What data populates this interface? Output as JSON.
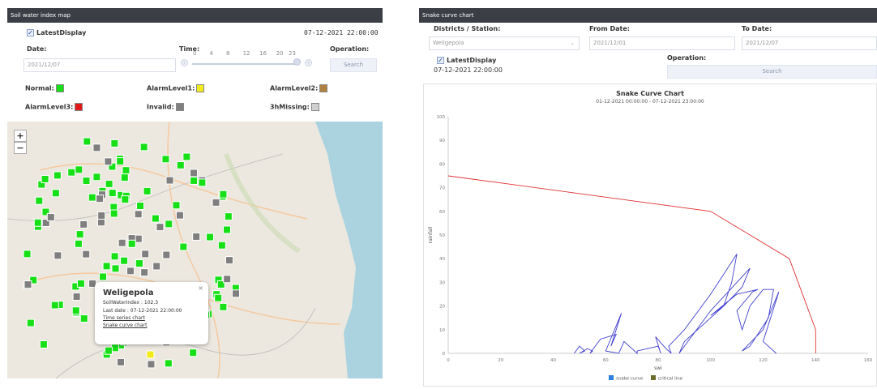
{
  "left": {
    "title": "Soil water index map",
    "latest_display_label": "LatestDisplay",
    "latest_display_checked": true,
    "timestamp": "07-12-2021 22:00:00",
    "date_label": "Date:",
    "date_value": "2021/12/07",
    "time_label": "Time:",
    "time_ticks": [
      "0",
      "4",
      "8",
      "12",
      "16",
      "20",
      "23"
    ],
    "time_slider_value": 23,
    "operation_label": "Operation:",
    "search_label": "Search",
    "legend": [
      {
        "label": "Normal:",
        "color": "#17e017"
      },
      {
        "label": "AlarmLevel1:",
        "color": "#f2ea1a"
      },
      {
        "label": "AlarmLevel2:",
        "color": "#b08040"
      },
      {
        "label": "AlarmLevel3:",
        "color": "#e01a1a"
      },
      {
        "label": "Invalid:",
        "color": "#808080"
      },
      {
        "label": "3hMissing:",
        "color": "#d0d0d0"
      }
    ],
    "zoom_in": "+",
    "zoom_out": "−",
    "popup": {
      "title": "Weligepola",
      "index_line": "SoilWaterIndex : 102.3",
      "date_line": "Last date : 07-12-2021 22:00:00",
      "link1": "Time series chart",
      "link2": "Snake curve chart",
      "close": "×"
    }
  },
  "right": {
    "title": "Snake curve chart",
    "district_label": "Districts / Station:",
    "district_value": "Weligepola",
    "from_label": "From Date:",
    "from_value": "2021/12/01",
    "to_label": "To Date:",
    "to_value": "2021/12/07",
    "latest_display_label": "LatestDisplay",
    "latest_display_checked": true,
    "timestamp": "07-12-2021 22:00:00",
    "operation_label": "Operation:",
    "search_label": "Search"
  },
  "chart_data": {
    "type": "line",
    "title": "Snake Curve Chart",
    "subtitle": "01-12-2021 00:00:00 - 07-12-2021 23:00:00",
    "xlabel": "swi",
    "ylabel": "rainfall",
    "xlim": [
      0,
      160
    ],
    "ylim": [
      0,
      100
    ],
    "xticks": [
      0,
      20,
      40,
      60,
      80,
      100,
      120,
      140,
      160
    ],
    "yticks": [
      0,
      10,
      20,
      30,
      40,
      50,
      60,
      70,
      80,
      90,
      100
    ],
    "grid": false,
    "legend_position": "bottom",
    "series": [
      {
        "name": "snake curve",
        "color": "#4040d0",
        "x": [
          48,
          50,
          52,
          50,
          53,
          55,
          54,
          58,
          64,
          62,
          66,
          60,
          65,
          67,
          70,
          72,
          72,
          80,
          81,
          79,
          83,
          85,
          84,
          90,
          100,
          110,
          108,
          105,
          95,
          90,
          88,
          100,
          115,
          112,
          105,
          100,
          110,
          118,
          116,
          110,
          112,
          115,
          120,
          124,
          122,
          115,
          112,
          120,
          126,
          120,
          125
        ],
        "y": [
          0,
          3,
          1,
          0,
          2,
          1,
          0,
          6,
          8,
          3,
          17,
          1,
          0,
          5,
          2,
          0,
          1,
          3,
          0,
          7,
          2,
          0,
          3,
          10,
          25,
          42,
          30,
          20,
          10,
          5,
          0,
          18,
          36,
          28,
          20,
          16,
          25,
          27,
          26,
          18,
          10,
          20,
          27,
          27,
          15,
          3,
          1,
          10,
          26,
          5,
          0
        ]
      },
      {
        "name": "critical line",
        "color": "#e03030",
        "x": [
          0,
          100,
          130,
          140,
          140
        ],
        "y": [
          75,
          60,
          40,
          10,
          0
        ]
      }
    ]
  }
}
